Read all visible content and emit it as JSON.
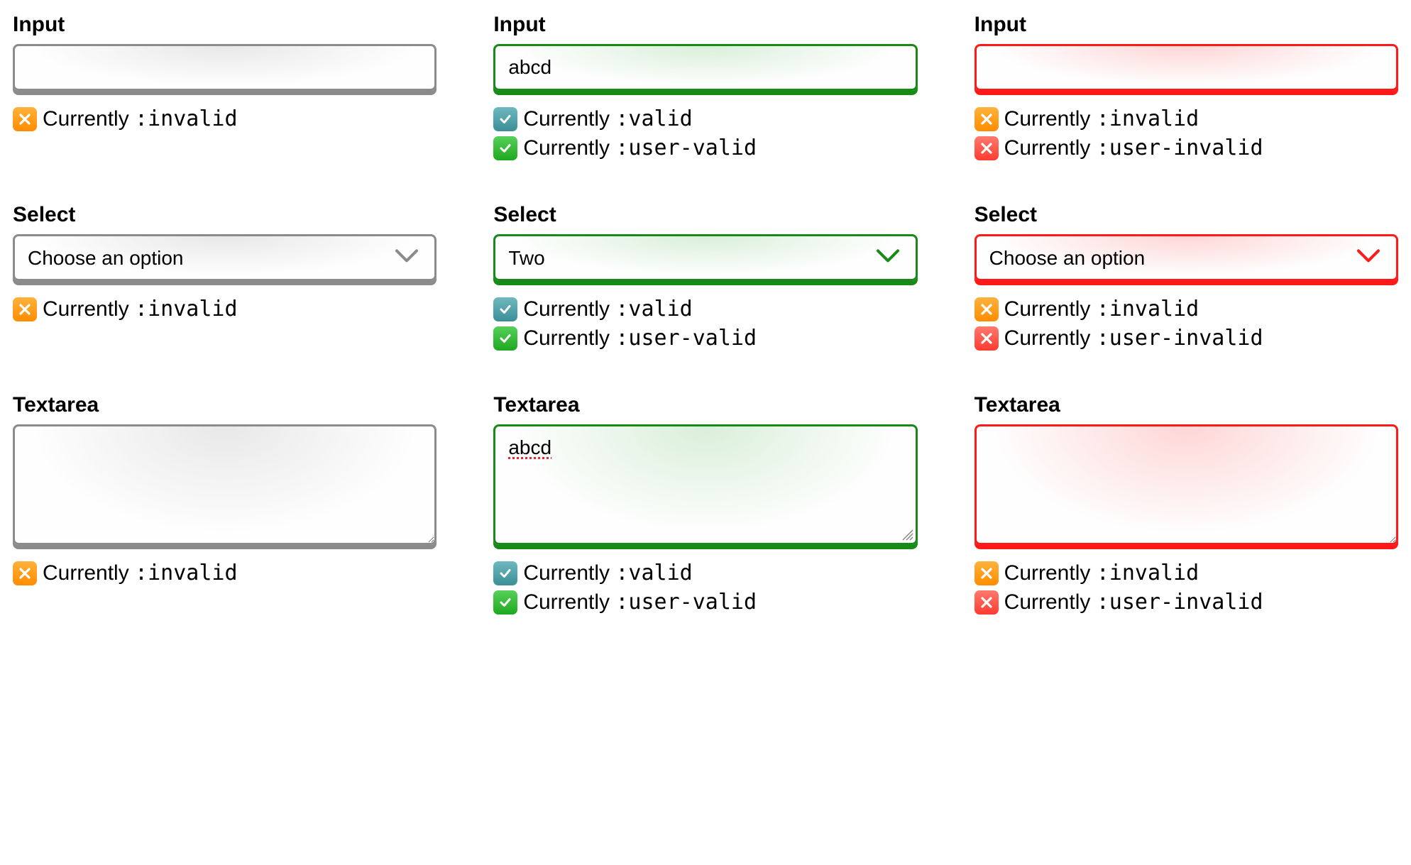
{
  "labels": {
    "input": "Input",
    "select": "Select",
    "textarea": "Textarea"
  },
  "status_prefix": "Currently ",
  "pseudo": {
    "invalid": ":invalid",
    "valid": ":valid",
    "user_valid": ":user-valid",
    "user_invalid": ":user-invalid"
  },
  "cols": {
    "neutral": {
      "input_value": "",
      "select_value": "Choose an option",
      "textarea_value": ""
    },
    "valid": {
      "input_value": "abcd",
      "select_value": "Two",
      "textarea_value": "abcd"
    },
    "invalid": {
      "input_value": "",
      "select_value": "Choose an option",
      "textarea_value": ""
    }
  },
  "colors": {
    "neutral": "#8b8b8b",
    "valid": "#178a17",
    "invalid": "#ff1a1a"
  }
}
